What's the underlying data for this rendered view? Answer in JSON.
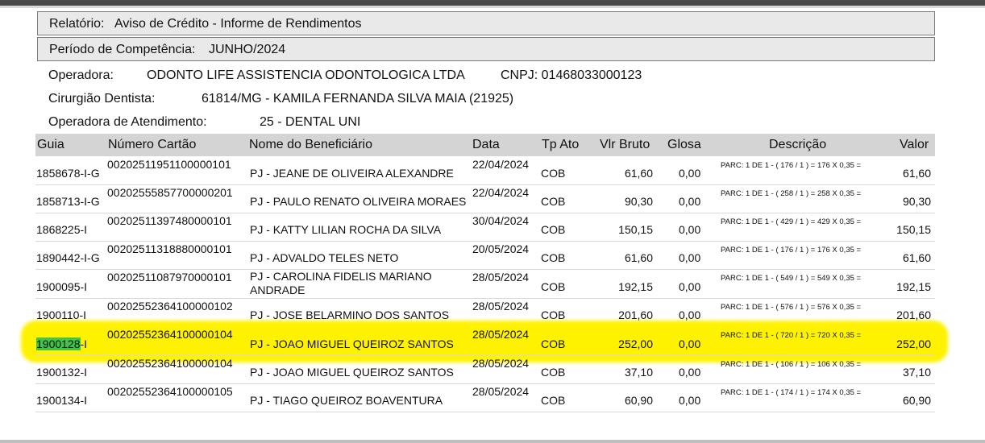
{
  "report": {
    "relatorio_label": "Relatório:",
    "relatorio_value": "Aviso de Crédito - Informe de Rendimentos",
    "periodo_label": "Período de Competência:",
    "periodo_value": "JUNHO/2024",
    "operadora_label": "Operadora:",
    "operadora_value": "ODONTO LIFE ASSISTENCIA ODONTOLOGICA LTDA",
    "cnpj_text": "CNPJ: 01468033000123",
    "cirurgiao_label": "Cirurgião Dentista:",
    "cirurgiao_value": "61814/MG - KAMILA FERNANDA SILVA MAIA (21925)",
    "atendimento_label": "Operadora de Atendimento:",
    "atendimento_value": "25 - DENTAL UNI"
  },
  "table": {
    "headers": {
      "guia": "Guia",
      "cartao": "Número Cartão",
      "nome": "Nome do Beneficiário",
      "data": "Data",
      "tpato": "Tp Ato",
      "vlrbruto": "Vlr Bruto",
      "glosa": "Glosa",
      "descricao": "Descrição",
      "valor": "Valor"
    },
    "rows": [
      {
        "guia": "1858678-I-G",
        "cartao": "00202511951100000101",
        "nome": "PJ - JEANE DE OLIVEIRA ALEXANDRE",
        "data": "22/04/2024",
        "tpato": "COB",
        "vlrbruto": "61,60",
        "glosa": "0,00",
        "descricao": "PARC: 1 DE 1 - ( 176 / 1 ) = 176 X 0,35 =",
        "valor": "61,60",
        "highlighted": false
      },
      {
        "guia": "1858713-I-G",
        "cartao": "00202555857700000201",
        "nome": "PJ - PAULO RENATO OLIVEIRA MORAES",
        "data": "22/04/2024",
        "tpato": "COB",
        "vlrbruto": "90,30",
        "glosa": "0,00",
        "descricao": "PARC: 1 DE 1 - ( 258 / 1 ) = 258 X 0,35 =",
        "valor": "90,30",
        "highlighted": false
      },
      {
        "guia": "1868225-I",
        "cartao": "00202511397480000101",
        "nome": "PJ - KATTY LILIAN ROCHA DA SILVA",
        "data": "30/04/2024",
        "tpato": "COB",
        "vlrbruto": "150,15",
        "glosa": "0,00",
        "descricao": "PARC: 1 DE 1 - ( 429 / 1 ) = 429 X 0,35 =",
        "valor": "150,15",
        "highlighted": false
      },
      {
        "guia": "1890442-I-G",
        "cartao": "00202511318880000101",
        "nome": "PJ - ADVALDO TELES NETO",
        "data": "20/05/2024",
        "tpato": "COB",
        "vlrbruto": "61,60",
        "glosa": "0,00",
        "descricao": "PARC: 1 DE 1 - ( 176 / 1 ) = 176 X 0,35 =",
        "valor": "61,60",
        "highlighted": false
      },
      {
        "guia": "1900095-I",
        "cartao": "00202511087970000101",
        "nome": "PJ - CAROLINA FIDELIS MARIANO ANDRADE",
        "data": "28/05/2024",
        "tpato": "COB",
        "vlrbruto": "192,15",
        "glosa": "0,00",
        "descricao": "PARC: 1 DE 1 - ( 549 / 1 ) = 549 X 0,35 =",
        "valor": "192,15",
        "highlighted": false
      },
      {
        "guia": "1900110-I",
        "cartao": "00202552364100000102",
        "nome": "PJ - JOSE BELARMINO DOS SANTOS",
        "data": "28/05/2024",
        "tpato": "COB",
        "vlrbruto": "201,60",
        "glosa": "0,00",
        "descricao": "PARC: 1 DE 1 - ( 576 / 1 ) = 576 X 0,35 =",
        "valor": "201,60",
        "highlighted": false
      },
      {
        "guia": "1900128-I",
        "cartao": "00202552364100000104",
        "nome": "PJ - JOAO MIGUEL QUEIROZ SANTOS",
        "data": "28/05/2024",
        "tpato": "COB",
        "vlrbruto": "252,00",
        "glosa": "0,00",
        "descricao": "PARC: 1 DE 1 - ( 720 / 1 ) = 720 X 0,35 =",
        "valor": "252,00",
        "highlighted": true
      },
      {
        "guia": "1900132-I",
        "cartao": "00202552364100000104",
        "nome": "PJ - JOAO MIGUEL QUEIROZ SANTOS",
        "data": "28/05/2024",
        "tpato": "COB",
        "vlrbruto": "37,10",
        "glosa": "0,00",
        "descricao": "PARC: 1 DE 1 - ( 106 / 1 ) = 106 X 0,35 =",
        "valor": "37,10",
        "highlighted": false
      },
      {
        "guia": "1900134-I",
        "cartao": "00202552364100000105",
        "nome": "PJ - TIAGO QUEIROZ BOAVENTURA",
        "data": "28/05/2024",
        "tpato": "COB",
        "vlrbruto": "60,90",
        "glosa": "0,00",
        "descricao": "PARC: 1 DE 1 - ( 174 / 1 ) = 174 X 0,35 =",
        "valor": "60,90",
        "highlighted": false
      }
    ]
  },
  "colors": {
    "highlight": "#fff200",
    "selection": "#3fc64a",
    "header_bg": "#d4d4d4",
    "box_bg": "#e9e9e9"
  }
}
